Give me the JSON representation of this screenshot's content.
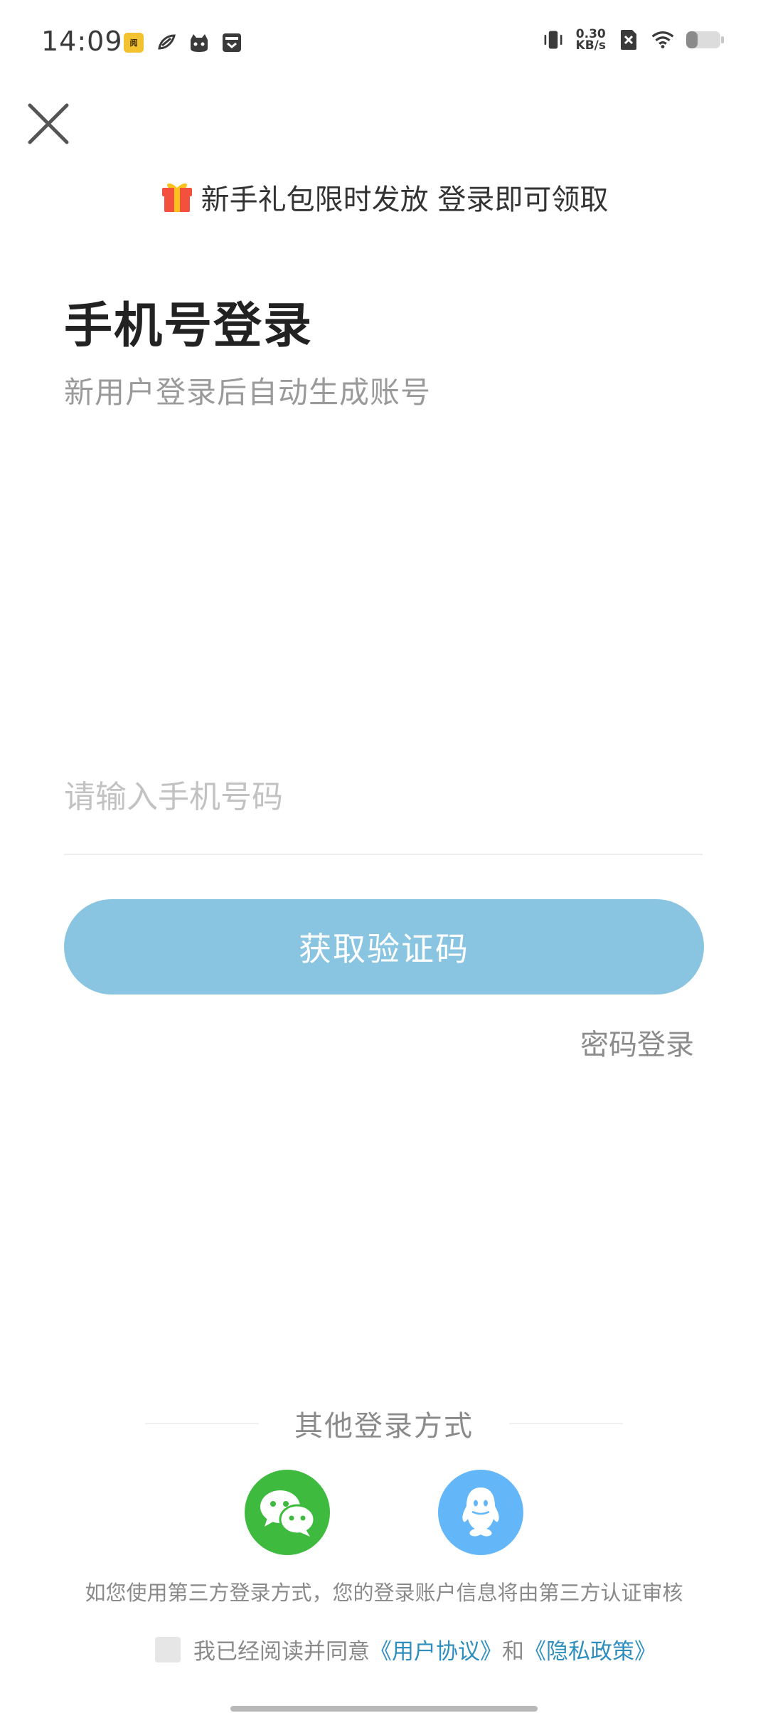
{
  "status_bar": {
    "time": "14:09",
    "net_speed_value": "0.30",
    "net_speed_unit": "KB/s",
    "left_icons": [
      "reading-app-icon",
      "bird-app-icon",
      "cat-app-icon",
      "inbox-app-icon"
    ],
    "right_icons": [
      "vibrate-icon",
      "sim-blocked-icon",
      "wifi-icon",
      "battery-icon"
    ]
  },
  "promo": {
    "icon": "gift-icon",
    "text": "新手礼包限时发放 登录即可领取"
  },
  "login": {
    "title": "手机号登录",
    "subtitle": "新用户登录后自动生成账号",
    "phone_placeholder": "请输入手机号码",
    "phone_value": "",
    "get_code_label": "获取验证码",
    "password_login_label": "密码登录"
  },
  "other_login": {
    "label": "其他登录方式",
    "providers": [
      {
        "name": "wechat",
        "icon": "wechat-icon"
      },
      {
        "name": "qq",
        "icon": "qq-icon"
      }
    ],
    "notice": "如您使用第三方登录方式，您的登录账户信息将由第三方认证审核"
  },
  "agreement": {
    "prefix": "我已经阅读并同意",
    "user_agreement": "《用户协议》",
    "and": "和",
    "privacy_policy": "《隐私政策》",
    "checked": false
  },
  "colors": {
    "primary_button": "#89c5e1",
    "link": "#2e8fbe",
    "wechat": "#3ebb3f",
    "qq": "#63b6f7"
  }
}
